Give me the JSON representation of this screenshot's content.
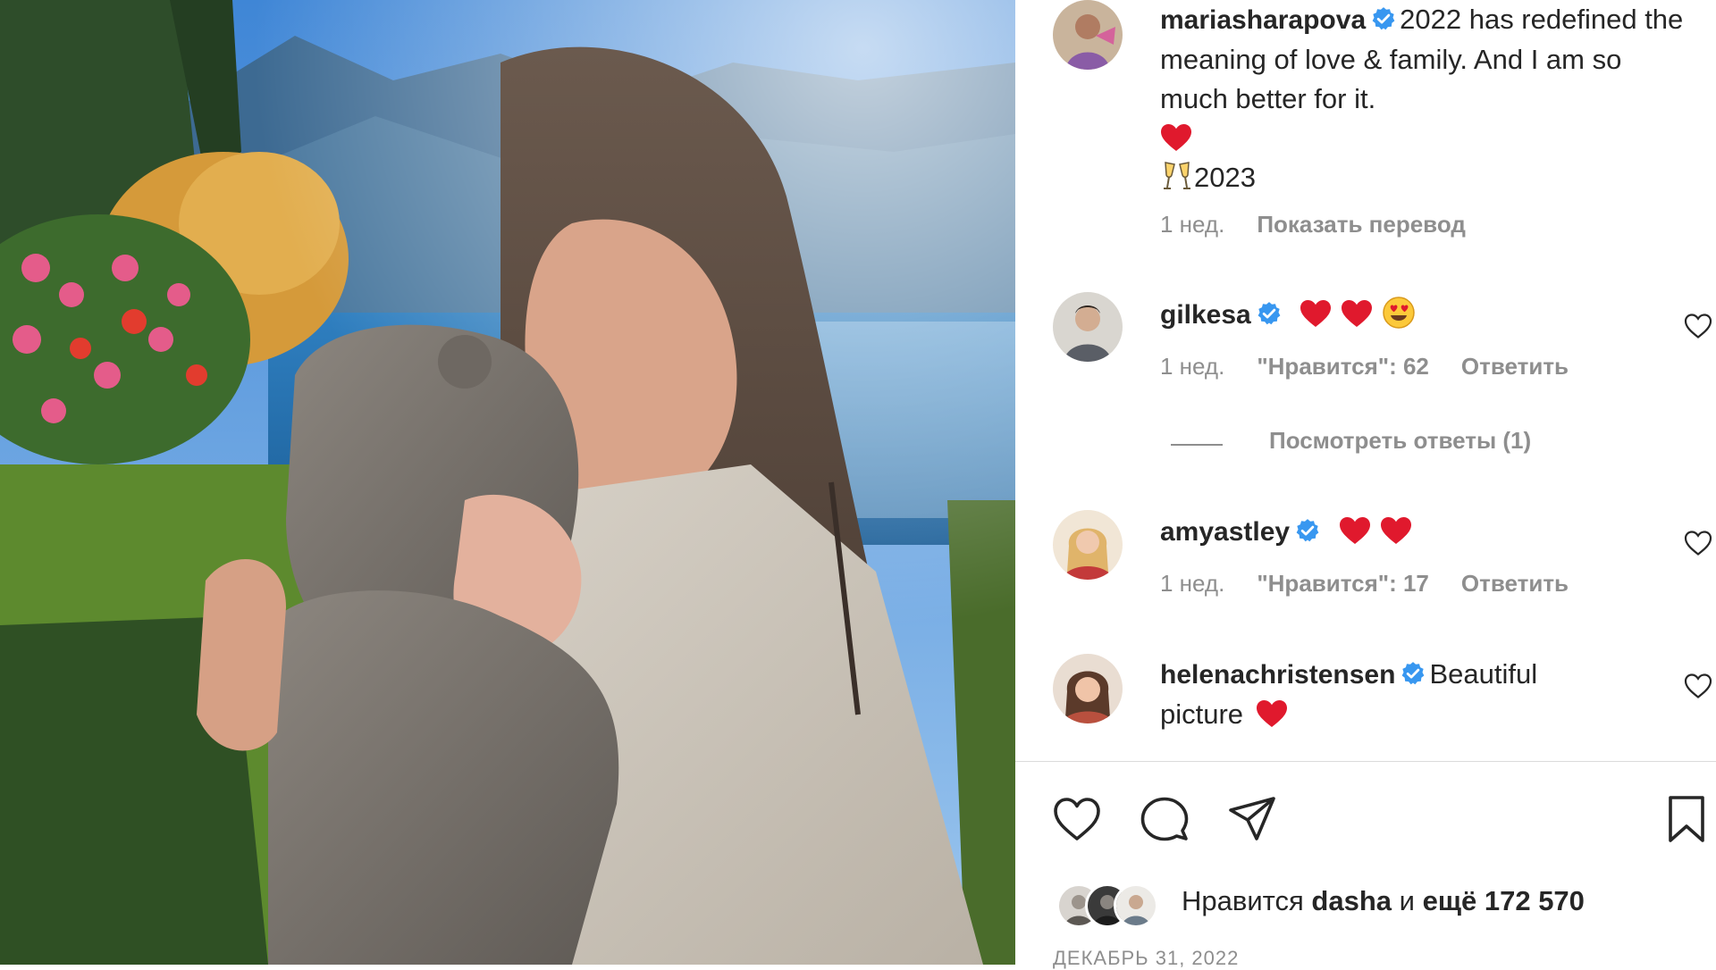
{
  "post": {
    "author": "mariasharapova",
    "caption_text": "2022 has redefined the meaning of love & family. And I am so much better for it.",
    "caption_year": "2023",
    "time": "1 нед.",
    "translate": "Показать перевод"
  },
  "comments": [
    {
      "user": "gilkesa",
      "text": "",
      "time": "1 нед.",
      "likes": "\"Нравится\": 62",
      "reply": "Ответить"
    },
    {
      "user": "amyastley",
      "text": "",
      "time": "1 нед.",
      "likes": "\"Нравится\": 17",
      "reply": "Ответить"
    },
    {
      "user": "helenachristensen",
      "text_line1": "Beautiful",
      "text_line2": "picture"
    }
  ],
  "view_replies": "Посмотреть ответы (1)",
  "footer": {
    "likes_prefix": "Нравится",
    "likes_user": "dasha",
    "likes_conj": "и",
    "likes_count": "ещё 172 570",
    "date": "ДЕКАБРЬ 31, 2022"
  },
  "icons": {
    "like": "heart-outline-icon",
    "comment": "speech-bubble-icon",
    "share": "paper-plane-icon",
    "save": "bookmark-icon"
  },
  "colors": {
    "verified": "#3897f0",
    "heart_red": "#e0192d",
    "muted": "#8e8e8e"
  }
}
